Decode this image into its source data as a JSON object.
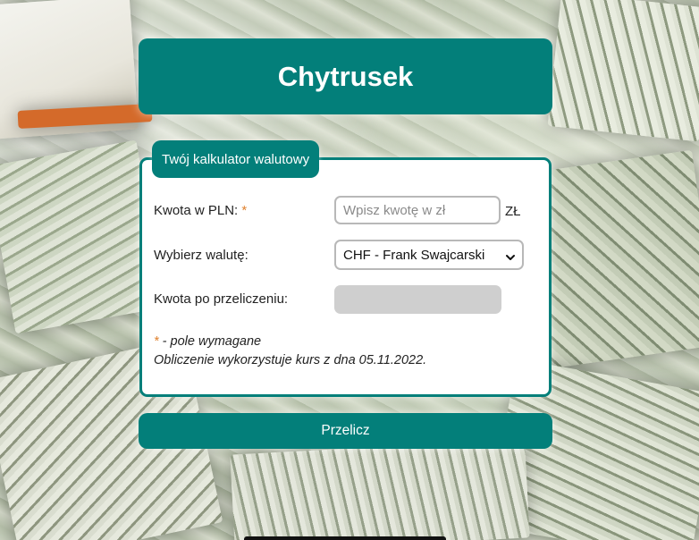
{
  "header": {
    "title": "Chytrusek"
  },
  "form": {
    "legend": "Twój kalkulator walutowy",
    "amount": {
      "label": "Kwota w PLN:",
      "required_mark": "*",
      "placeholder": "Wpisz kwotę w zł",
      "value": "",
      "unit": "ZŁ"
    },
    "currency": {
      "label": "Wybierz walutę:",
      "selected": "CHF - Frank Swajcarski"
    },
    "result": {
      "label": "Kwota po przeliczeniu:",
      "value": ""
    },
    "notes": {
      "required_mark": "*",
      "required_text": " - pole wymagane",
      "rate_info": "Obliczenie wykorzystuje kurs z dna 05.11.2022."
    },
    "submit_label": "Przelicz"
  },
  "colors": {
    "primary": "#037f7a",
    "required": "#e0822f",
    "disabled_field": "#cfcfcf"
  },
  "icons": {
    "select_arrow": "chevron-down-icon"
  }
}
